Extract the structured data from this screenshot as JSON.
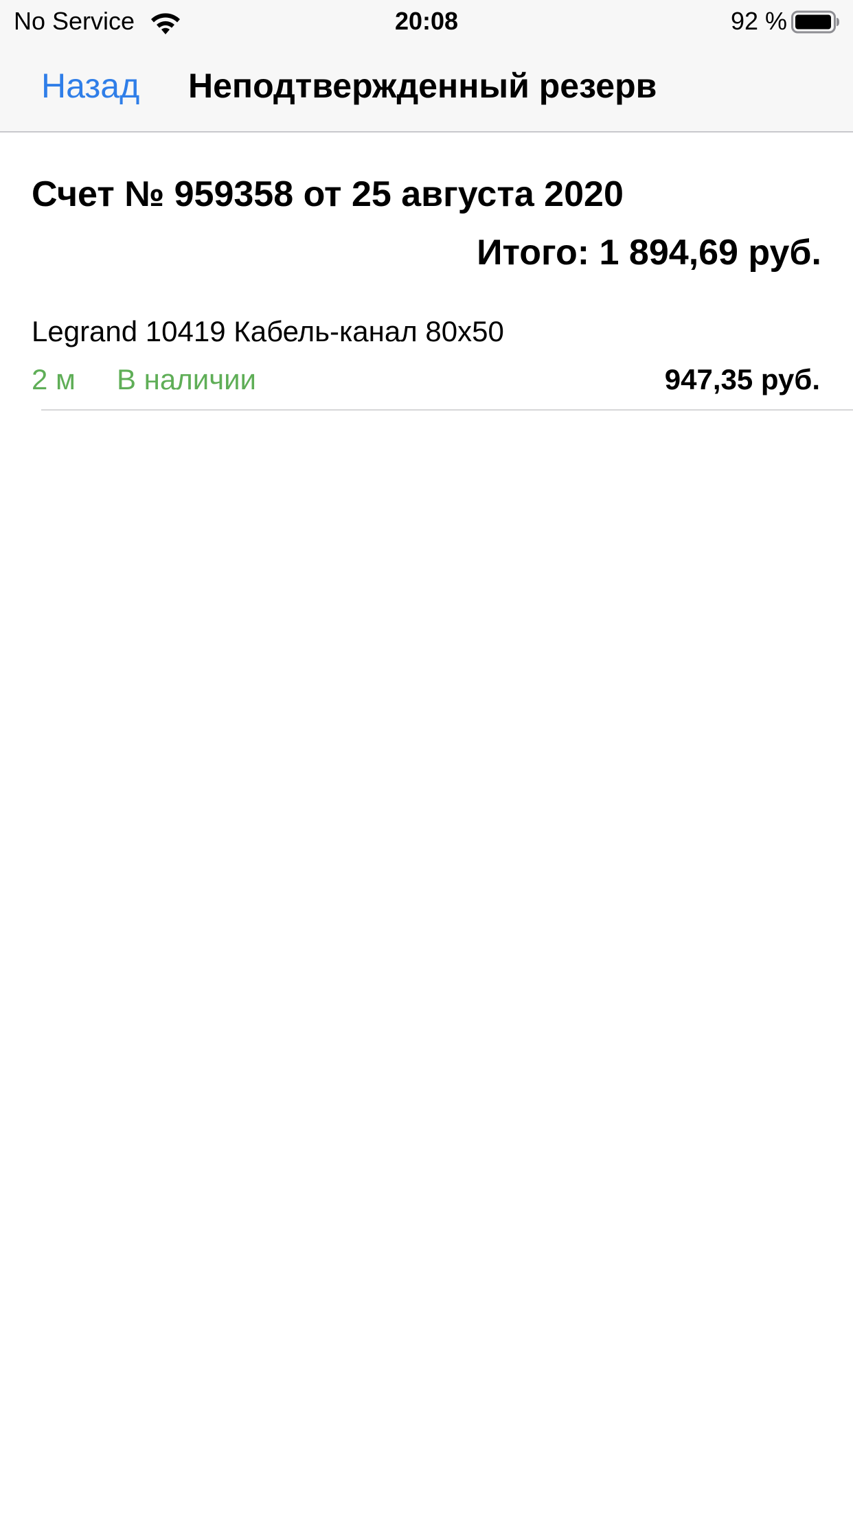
{
  "status_bar": {
    "carrier": "No Service",
    "time": "20:08",
    "battery_percent": "92 %",
    "wifi_icon": "wifi-icon",
    "battery_icon": "battery-icon"
  },
  "nav": {
    "back_label": "Назад",
    "title": "Неподтвержденный резерв",
    "accent_color": "#2f7ee8"
  },
  "invoice": {
    "title": "Счет № 959358 от 25 августа 2020",
    "total": "Итого: 1 894,69 руб."
  },
  "items": [
    {
      "name": "Legrand 10419 Кабель-канал 80х50",
      "quantity": "2 м",
      "availability": "В наличии",
      "price": "947,35 руб.",
      "status_color": "#5fae57"
    }
  ]
}
